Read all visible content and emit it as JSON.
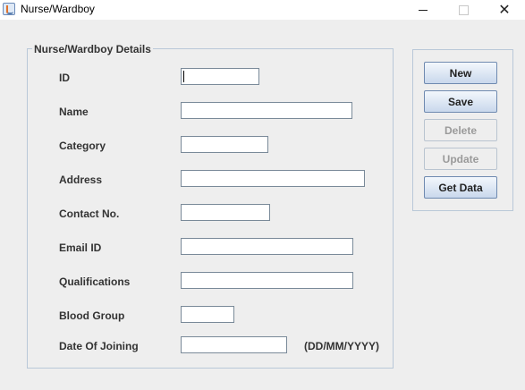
{
  "window": {
    "title": "Nurse/Wardboy",
    "close_glyph": "✕"
  },
  "form": {
    "panel_title": "Nurse/Wardboy Details",
    "fields": [
      {
        "label": "ID",
        "value": ""
      },
      {
        "label": "Name",
        "value": ""
      },
      {
        "label": "Category",
        "value": ""
      },
      {
        "label": "Address",
        "value": ""
      },
      {
        "label": "Contact No.",
        "value": ""
      },
      {
        "label": "Email ID",
        "value": ""
      },
      {
        "label": "Qualifications",
        "value": ""
      },
      {
        "label": "Blood Group",
        "value": ""
      },
      {
        "label": "Date Of Joining",
        "value": ""
      }
    ],
    "date_hint": "(DD/MM/YYYY)"
  },
  "actions": {
    "new": "New",
    "save": "Save",
    "delete": "Delete",
    "update": "Update",
    "get_data": "Get Data"
  },
  "colors": {
    "background": "#eeeeee",
    "border": "#b9c8d8",
    "disabled_text": "#9a9a9a"
  }
}
